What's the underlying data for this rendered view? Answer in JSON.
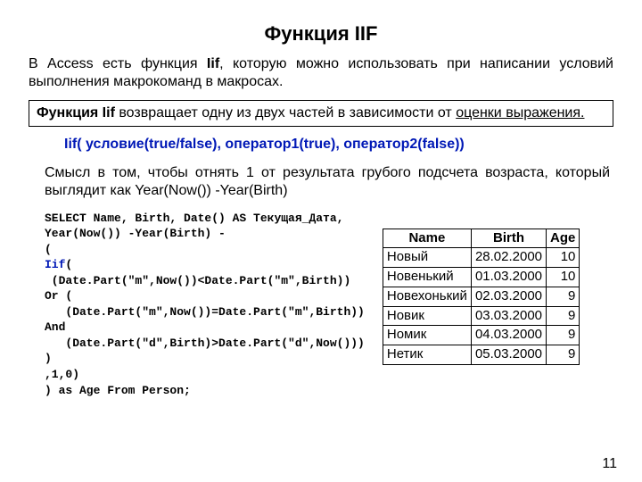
{
  "title": "Функция IIF",
  "intro_p1": "В Access есть функция ",
  "intro_fn": "Iif",
  "intro_p2": ", которую можно использовать при написании условий выполнения макрокоманд в макросах.",
  "def_b1": "Функция Iif ",
  "def_rest": "возвращает одну из двух частей в зависимости от ",
  "def_u": "оценки выражения.",
  "signature": "Iif( условие(true/false), оператор1(true), оператор2(false))",
  "para2": "Смысл в том, чтобы отнять 1 от результата грубого подсчета возраста, который выглядит как Year(Now()) -Year(Birth)",
  "code": [
    "SELECT Name, Birth, Date() AS Текущая_Дата,",
    "Year(Now()) -Year(Birth) -",
    "(",
    "IIF_KW",
    " (Date.Part(\"m\",Now())<Date.Part(\"m\",Birth))",
    "Or (",
    "   (Date.Part(\"m\",Now())=Date.Part(\"m\",Birth))",
    "And",
    "   (Date.Part(\"d\",Birth)>Date.Part(\"d\",Now()))",
    ")",
    ",1,0)",
    ") as Age From Person;"
  ],
  "iif_kw": "Iif",
  "table": {
    "headers": [
      "Name",
      "Birth",
      "Age"
    ],
    "rows": [
      [
        "Новый",
        "28.02.2000",
        "10"
      ],
      [
        "Новенький",
        "01.03.2000",
        "10"
      ],
      [
        "Новехонький",
        "02.03.2000",
        "9"
      ],
      [
        "Новик",
        "03.03.2000",
        "9"
      ],
      [
        "Номик",
        "04.03.2000",
        "9"
      ],
      [
        "Нетик",
        "05.03.2000",
        "9"
      ]
    ]
  },
  "pagenum": "11"
}
